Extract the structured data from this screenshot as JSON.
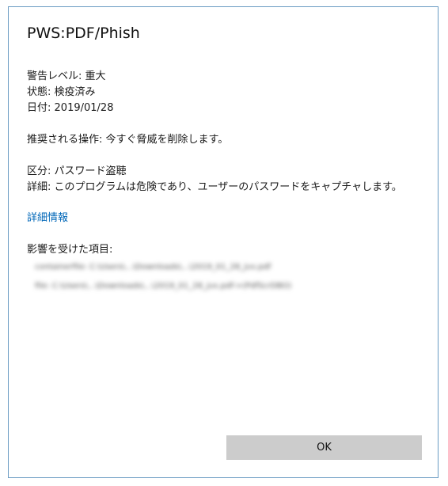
{
  "dialog": {
    "title": "PWS:PDF/Phish",
    "details": [
      {
        "label": "警告レベル:",
        "value": "重大"
      },
      {
        "label": "状態:",
        "value": "検疫済み"
      },
      {
        "label": "日付:",
        "value": "2019/01/28"
      }
    ],
    "recommended_action": {
      "label": "推奨される操作:",
      "value": "今すぐ脅威を削除します。"
    },
    "category": {
      "label": "区分:",
      "value": "パスワード盗聴"
    },
    "description": {
      "label": "詳細:",
      "value": "このプログラムは危険であり、ユーザーのパスワードをキャプチャします。"
    },
    "more_info_link": "詳細情報",
    "affected_items_label": "影響を受けた項目:",
    "affected_items": [
      "containerfile: C:\\Users\\...\\Downloads\\...\\2019_01_28_jvx.pdf",
      "file: C:\\Users\\...\\Downloads\\...\\2019_01_28_jvx.pdf->(PdfScrDBO)"
    ],
    "ok_label": "OK"
  },
  "colors": {
    "border": "#6a9bc3",
    "link": "#0067b8",
    "button_bg": "#cccccc"
  }
}
